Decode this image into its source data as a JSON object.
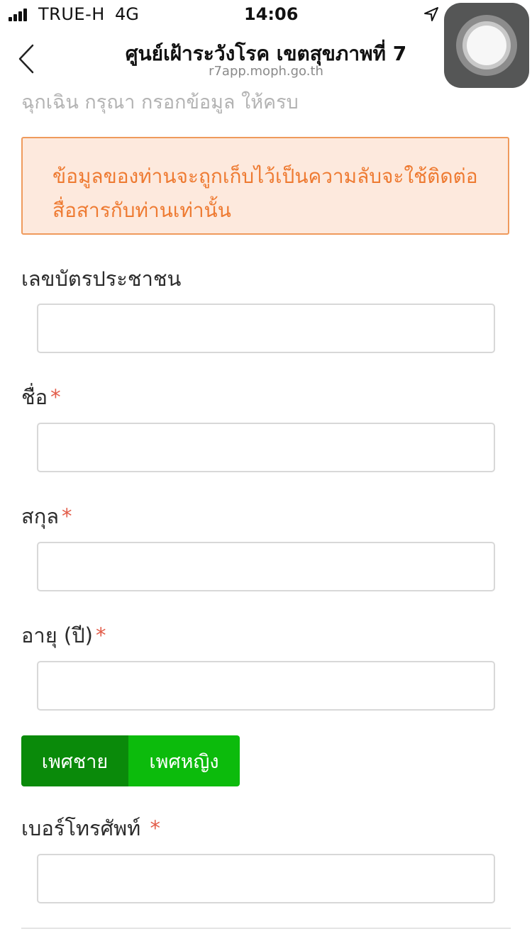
{
  "status_bar": {
    "carrier": "TRUE-H",
    "network": "4G",
    "time": "14:06"
  },
  "nav": {
    "title": "ศูนย์เฝ้าระวังโรค เขตสุขภาพที่ 7",
    "url": "r7app.moph.go.th"
  },
  "form": {
    "subtitle": "ฉุกเฉิน กรุณา กรอกข้อมูล ให้ครบ",
    "notice": "ข้อมูลของท่านจะถูกเก็บไว้เป็นความลับจะใช้ติดต่อสื่อสารกับท่านเท่านั้น",
    "required_mark": "*",
    "fields": {
      "national_id": {
        "label": "เลขบัตรประชาชน",
        "value": ""
      },
      "first_name": {
        "label": "ชื่อ",
        "value": ""
      },
      "last_name": {
        "label": "สกุล",
        "value": ""
      },
      "age": {
        "label": "อายุ (ปี)",
        "value": ""
      },
      "phone": {
        "label": "เบอร์โทรศัพท์ ",
        "value": ""
      }
    },
    "gender": {
      "male": "เพศชาย",
      "female": "เพศหญิง",
      "selected": "male"
    }
  },
  "colors": {
    "notice_bg": "#fde9dd",
    "notice_text": "#ee7a31",
    "required": "#e25d4a",
    "male_selected": "#0a8a0a",
    "female": "#0cbb0c"
  },
  "icons": {
    "back": "chevron-left-icon",
    "location": "location-arrow-icon",
    "assistive_touch": "assistive-touch-icon"
  }
}
